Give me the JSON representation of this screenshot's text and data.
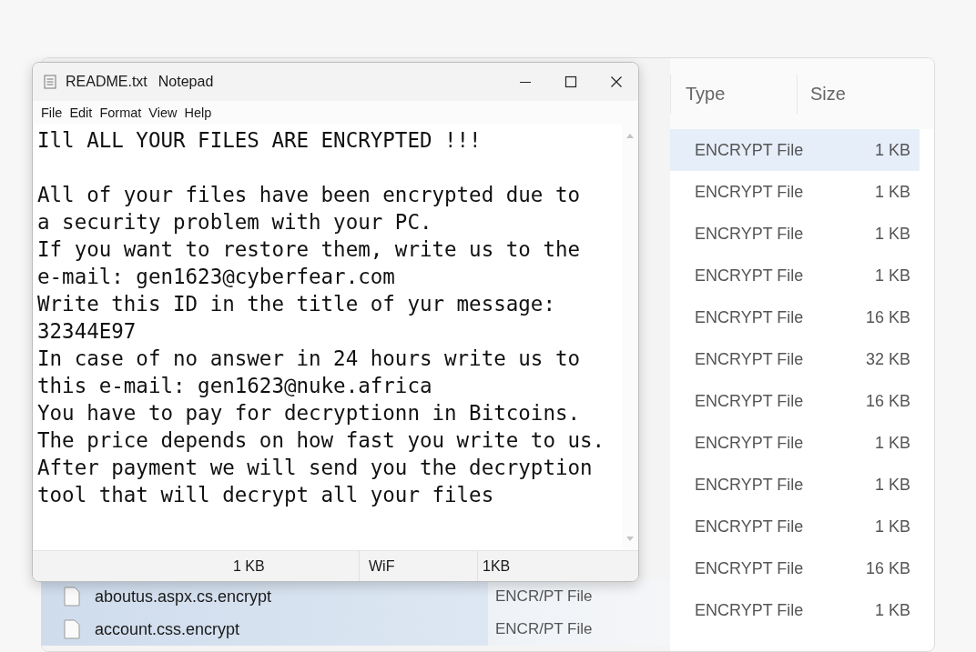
{
  "explorer": {
    "columns": [
      "Type",
      "Size"
    ],
    "rows": [
      {
        "type": "ENCRYPT File",
        "size": "1 KB",
        "selected": true
      },
      {
        "type": "ENCRYPT File",
        "size": "1 KB",
        "selected": false
      },
      {
        "type": "ENCRYPT File",
        "size": "1 KB",
        "selected": false
      },
      {
        "type": "ENCRYPT File",
        "size": "1 KB",
        "selected": false
      },
      {
        "type": "ENCRYPT File",
        "size": "16 KB",
        "selected": false
      },
      {
        "type": "ENCRYPT File",
        "size": "32 KB",
        "selected": false
      },
      {
        "type": "ENCRYPT File",
        "size": "16 KB",
        "selected": false
      },
      {
        "type": "ENCRYPT File",
        "size": "1 KB",
        "selected": false
      },
      {
        "type": "ENCRYPT File",
        "size": "1 KB",
        "selected": false
      },
      {
        "type": "ENCRYPT File",
        "size": "1 KB",
        "selected": false
      },
      {
        "type": "ENCRYPT File",
        "size": "16 KB",
        "selected": false
      },
      {
        "type": "ENCRYPT File",
        "size": "1 KB",
        "selected": false
      }
    ],
    "lower_rows": [
      {
        "name": "aboutus.aspx.cs.encrypt",
        "type": "ENCR/PT File",
        "selected": true
      },
      {
        "name": "account.css.encrypt",
        "type": "ENCR/PT File",
        "selected": true
      }
    ]
  },
  "notepad": {
    "title": "README.txt",
    "app": "Notepad",
    "menu": [
      "File",
      "Edit",
      "Format",
      "View",
      "Help"
    ],
    "heading": "Ill ALL YOUR FILES ARE ENCRYPTED !!!",
    "lines": [
      "All of your files have been encrypted due to",
      "a security problem with your PC.",
      "If you want to restore them, write us to the",
      "e-mail: gen1623@cyberfear.com",
      "Write this ID in the title of yur message:",
      "32344E97",
      "In case of no answer in 24 hours write us to",
      "this e-mail: gen1623@nuke.africa",
      "You have to pay for decryptionn in Bitcoins.",
      "The price depends on how fast you write to us.",
      "After payment we will send you the decryption",
      "tool that will decrypt all your files"
    ],
    "status": [
      "1 KB",
      "WiF",
      "1KB"
    ]
  }
}
